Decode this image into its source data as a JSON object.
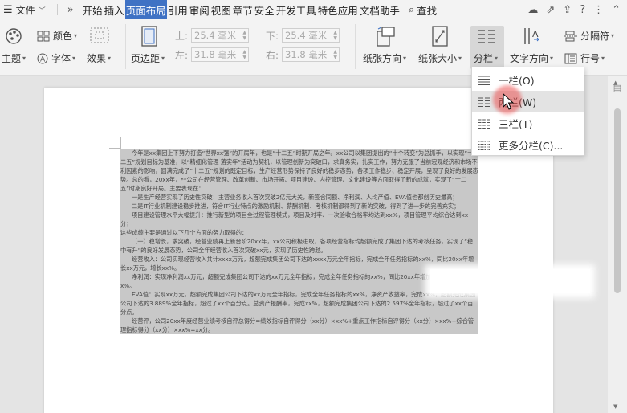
{
  "menubar": {
    "file_label": "文件",
    "tabs": [
      "开始",
      "插入",
      "页面布局",
      "引用",
      "审阅",
      "视图",
      "章节",
      "安全",
      "开发工具",
      "特色应用",
      "文档助手"
    ],
    "active_tab_index": 2,
    "search_label": "查找"
  },
  "ribbon": {
    "theme_label": "主题",
    "colors_label": "颜色",
    "fonts_label": "字体",
    "effects_label": "效果",
    "margins_label": "页边距",
    "top_label": "上:",
    "top_value": "25.4 毫米",
    "bottom_label": "下:",
    "bottom_value": "25.4 毫米",
    "left_label": "左:",
    "left_value": "31.8 毫米",
    "right_label": "右:",
    "right_value": "31.8 毫米",
    "orientation_label": "纸张方向",
    "size_label": "纸张大小",
    "columns_label": "分栏",
    "text_direction_label": "文字方向",
    "column_break_label": "分隔符",
    "line_number_label": "行号"
  },
  "columns_menu": {
    "items": [
      {
        "label": "一栏(O)",
        "cols": 1
      },
      {
        "label": "两栏(W)",
        "cols": 2
      },
      {
        "label": "三栏(T)",
        "cols": 3
      },
      {
        "label": "更多分栏(C)...",
        "cols": 4
      }
    ],
    "hovered_index": 1
  },
  "document": {
    "paragraphs": [
      "今年是xx集团上下努力打造“世界xx强”的开局年，也是“十二五”时期开局之年。xx公司以集团提出的“十个转变”为总抓手，以实现“十二五”规划目标为基准，以“精细化管理·落实年”活动为契机，以管理创新为突破口，求真务实，扎实工作，努力克服了当前宏观经济和市场不利因素的影响，圆满完成了“十二五”规划的既定目标，生产经营形势保持了良好的稳步态势，各项工作稳步、稳定开展，呈现了良好的发展态势。总的看，20xx年，**公司在经营管理、改革创新、市场开拓、项目建设、内控管理、文化建设等方面取得了新的成就，实现了“十二五”时期良好开局。主要表现在：",
      "一是生产经营实现了历史性突破：主营业务收入首次突破2亿元大关，新签合同额、净利润、人均产值、EVA值也都创历史最高；",
      "二是IT行业机制建设稳步推进，符合IT行业特点的激励机制、薪酬机制、考核机制都得到了新的突破，得到了进一步的完善充实；",
      "项目建设管理水平大幅提升：推行新型的项目全过程管理模式，项目及时率、一次验收合格率均达到xx%，项目管理平均综合达到xx分；",
      "这些成绩主要是通过以下几个方面的努力取得的：",
      "（一）稳增长，求突破，经营业绩再上新台阶20xx年，xx公司积极进取，各项经营指标均超额完成了集团下达的考核任务，实现了“稳中有升”的良好发展态势，公司全年经营收入首次突破xx元，实现了历史性跨越。",
      "经营收入：公司实现经营收入共计xxxx万元，超额完成集团公司下达的xxxx万元全年指标，完成全年任务指标的xx%，同比20xx年增长xx万元，增长xx%。",
      "净利润：实现净利润xx万元，超额完成集团公司下达的xx万元全年指标，完成全年任务指标的xx%，同比20xx年增加xx万元，增长xx%。",
      "EVA值：实现xx万元，超额完成集团公司下达的xx万元全年指标，完成全年任务指标的xx%，净资产收益率，完成xx%，超额完成集团公司下达的3.889%全年指标，超过了xx个百分点。总资产报酬率，完成xx%，超额完成集团公司下达的2.597%全年指标，超过了xx个百分点。",
      "经营评，公司20xx年度经营业绩考核自评总得分=绩效指标自评得分（xx分）×xx%+重点工作指标自评得分（xx分）×xx%+综合管理指标得分（xx分）×xx%=xx分。"
    ]
  }
}
